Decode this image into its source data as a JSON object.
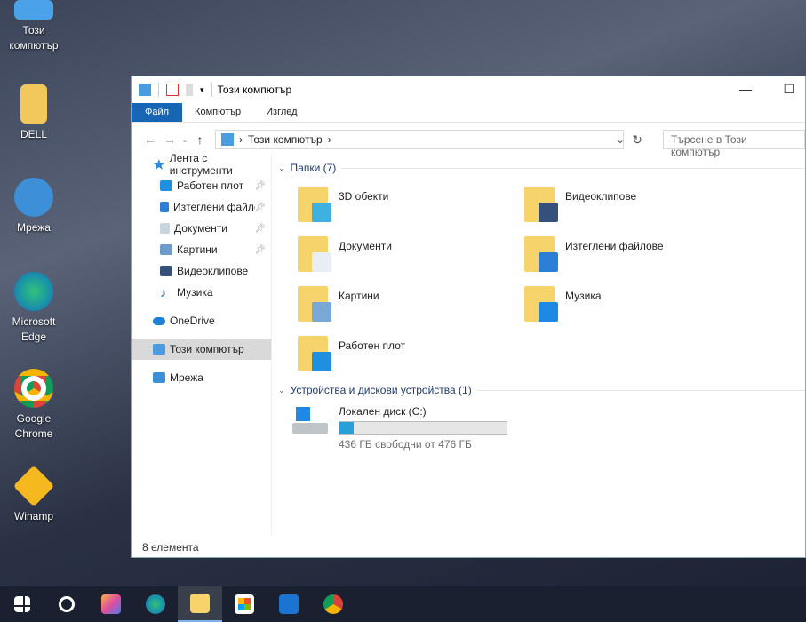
{
  "desktop": {
    "icons": [
      {
        "label": "Този компютър"
      },
      {
        "label": "DELL"
      },
      {
        "label": "Мрежа"
      },
      {
        "label": "Microsoft Edge"
      },
      {
        "label": "Google Chrome"
      },
      {
        "label": "Winamp"
      }
    ]
  },
  "window": {
    "title": "Този компютър",
    "minimize": "—",
    "maximize": "☐",
    "ribbon": {
      "tabs": [
        "Файл",
        "Компютър",
        "Изглед"
      ]
    },
    "address": {
      "path": "Този компютър",
      "search_placeholder": "Търсене в Този компютър"
    },
    "nav": {
      "quick_access": "Лента с инструменти",
      "items": [
        {
          "label": "Работен плот",
          "pinned": true,
          "color": "#1f8fe0"
        },
        {
          "label": "Изтеглени файлове",
          "pinned": true,
          "color": "#2d7fd6"
        },
        {
          "label": "Документи",
          "pinned": true,
          "color": "#c9d4df"
        },
        {
          "label": "Картини",
          "pinned": true,
          "color": "#6d9ccc"
        },
        {
          "label": "Видеоклипове",
          "pinned": false,
          "color": "#35507a"
        },
        {
          "label": "Музика",
          "pinned": false,
          "color": "#1e88e5"
        }
      ],
      "onedrive": "OneDrive",
      "this_pc": "Този компютър",
      "network": "Мрежа"
    },
    "content": {
      "folders_header": "Папки (7)",
      "folders": [
        {
          "name": "3D обекти",
          "accent": "#3fb0e0"
        },
        {
          "name": "Видеоклипове",
          "accent": "#35507a"
        },
        {
          "name": "Документи",
          "accent": "#e8eef4"
        },
        {
          "name": "Изтеглени файлове",
          "accent": "#2d7fd6"
        },
        {
          "name": "Картини",
          "accent": "#7aa8d6"
        },
        {
          "name": "Музика",
          "accent": "#1e88e5"
        },
        {
          "name": "Работен плот",
          "accent": "#1f8fe0"
        }
      ],
      "devices_header": "Устройства и дискови устройства (1)",
      "drive": {
        "name": "Локален диск (C:)",
        "free_text": "436 ГБ свободни от 476 ГБ",
        "used_fraction": 0.084
      }
    },
    "status": "8 елемента"
  },
  "taskbar": {
    "items": [
      "start",
      "search",
      "copilot",
      "edge",
      "file-explorer",
      "store",
      "outlook",
      "chrome"
    ]
  }
}
